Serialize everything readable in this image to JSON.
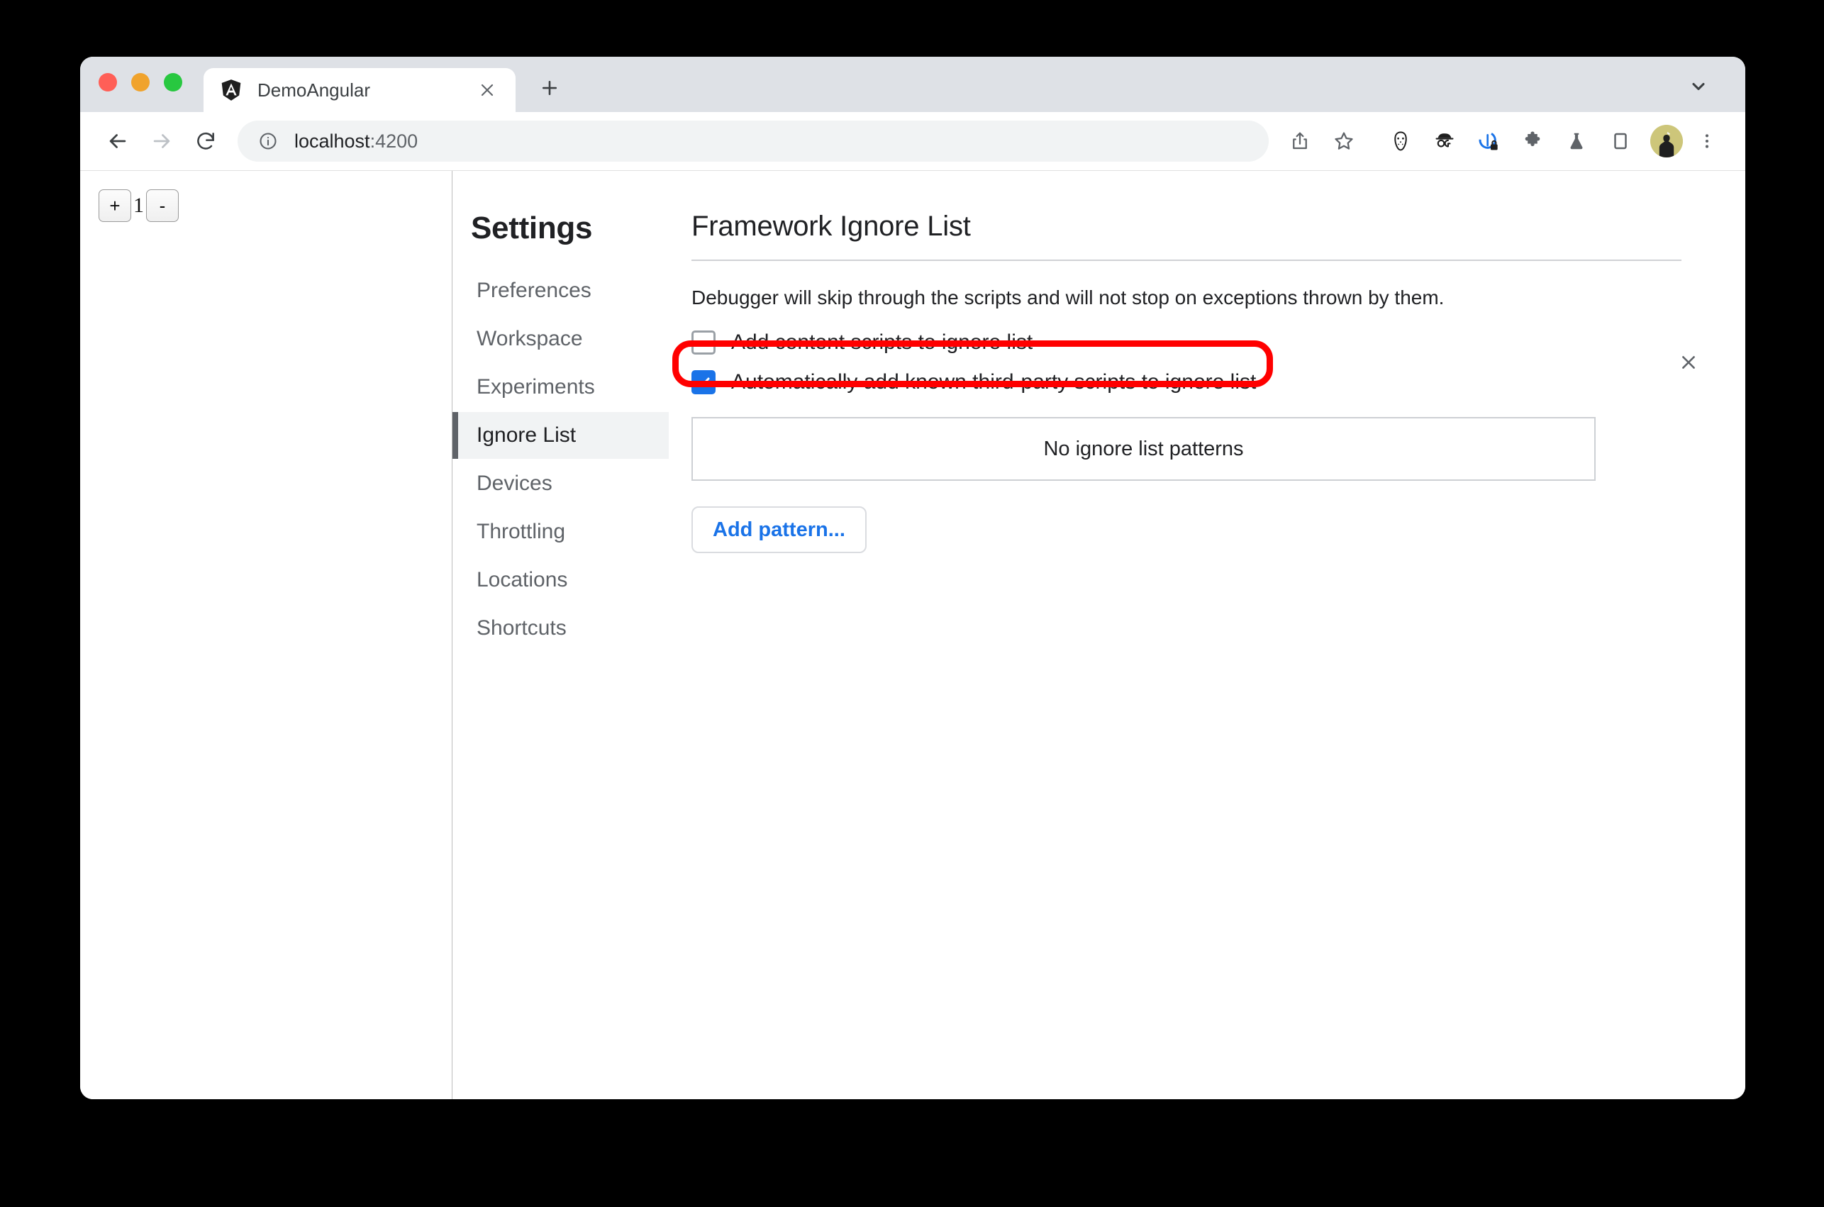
{
  "browser": {
    "traffic_lights": [
      "close",
      "minimize",
      "maximize"
    ],
    "tab": {
      "title": "DemoAngular",
      "favicon_name": "angular-logo-icon",
      "close_label": "×"
    },
    "new_tab_label": "+",
    "tab_list_icon": "chevron-down-icon",
    "toolbar": {
      "back_icon": "back-arrow-icon",
      "forward_icon": "forward-arrow-icon",
      "reload_icon": "reload-icon",
      "info_icon": "info-circle-icon",
      "url_host": "localhost",
      "url_port": ":4200",
      "icons": [
        "share-icon",
        "bookmark-star-icon",
        "hockey-mask-extension-icon",
        "og-incognito-glasses-extension-icon",
        "privacy-lock-shield-extension-icon",
        "puzzle-extensions-icon",
        "beaker-flask-extension-icon",
        "side-panel-icon"
      ],
      "avatar_name": "user-avatar",
      "menu_icon": "three-dot-menu-icon"
    }
  },
  "page": {
    "counter": {
      "increment_label": "+",
      "value": "1",
      "decrement_label": "-"
    }
  },
  "devtools": {
    "close_label": "✕",
    "settings": {
      "title": "Settings",
      "nav_items": [
        {
          "label": "Preferences",
          "selected": false
        },
        {
          "label": "Workspace",
          "selected": false
        },
        {
          "label": "Experiments",
          "selected": false
        },
        {
          "label": "Ignore List",
          "selected": true
        },
        {
          "label": "Devices",
          "selected": false
        },
        {
          "label": "Throttling",
          "selected": false
        },
        {
          "label": "Locations",
          "selected": false
        },
        {
          "label": "Shortcuts",
          "selected": false
        }
      ],
      "content": {
        "heading": "Framework Ignore List",
        "description": "Debugger will skip through the scripts and will not stop on exceptions thrown by them.",
        "checkboxes": [
          {
            "label": "Add content scripts to ignore list",
            "checked": false
          },
          {
            "label": "Automatically add known third-party scripts to ignore list",
            "checked": true
          }
        ],
        "empty_patterns_text": "No ignore list patterns",
        "add_pattern_label": "Add pattern..."
      }
    }
  },
  "annotation": {
    "shape": "rounded-rectangle",
    "color": "#ff0000",
    "targets": "automatically-add-third-party-scripts-checkbox"
  },
  "colors": {
    "accent_blue": "#1a73e8",
    "annotation_red": "#ff0000",
    "tabstrip_bg": "#dee1e6",
    "omnibox_bg": "#f1f3f4",
    "nav_selected_bg": "#f1f3f4",
    "text_primary": "#202124",
    "text_secondary": "#5f6368"
  }
}
